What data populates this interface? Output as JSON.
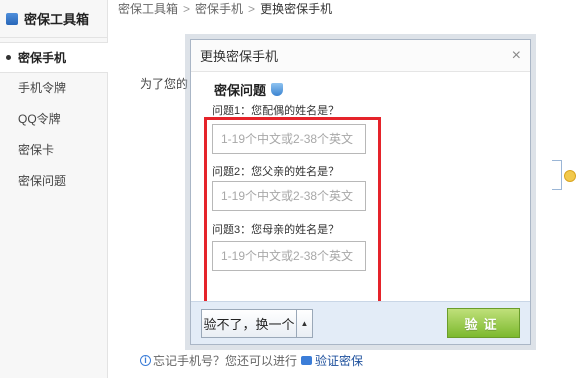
{
  "sidebar": {
    "title": "密保工具箱",
    "items": [
      {
        "label": "密保手机",
        "active": true
      },
      {
        "label": "手机令牌",
        "active": false
      },
      {
        "label": "QQ令牌",
        "active": false
      },
      {
        "label": "密保卡",
        "active": false
      },
      {
        "label": "密保问题",
        "active": false
      }
    ]
  },
  "breadcrumb": {
    "items": [
      "密保工具箱",
      "密保手机",
      "更换密保手机"
    ],
    "separator": ">"
  },
  "background": {
    "desc_text": "为了您的"
  },
  "modal": {
    "title": "更换密保手机",
    "close_symbol": "×",
    "section_title": "密保问题",
    "questions": [
      {
        "label": "问题1：您配偶的姓名是？",
        "placeholder": "1-19个中文或2-38个英文",
        "value": ""
      },
      {
        "label": "问题2：您父亲的姓名是？",
        "placeholder": "1-19个中文或2-38个英文",
        "value": ""
      },
      {
        "label": "问题3：您母亲的姓名是？",
        "placeholder": "1-19个中文或2-38个英文",
        "value": ""
      }
    ],
    "switch_button_label": "验不了，换一个",
    "switch_arrow": "▲",
    "verify_button_label": "验证"
  },
  "bottom_hint": {
    "text": "忘记手机号？您还可以进行",
    "link_label": "验证密保"
  },
  "colors": {
    "highlight": "#e5232a",
    "verify_button": "#7cb92e",
    "footer_bg": "#e3ecf7"
  }
}
